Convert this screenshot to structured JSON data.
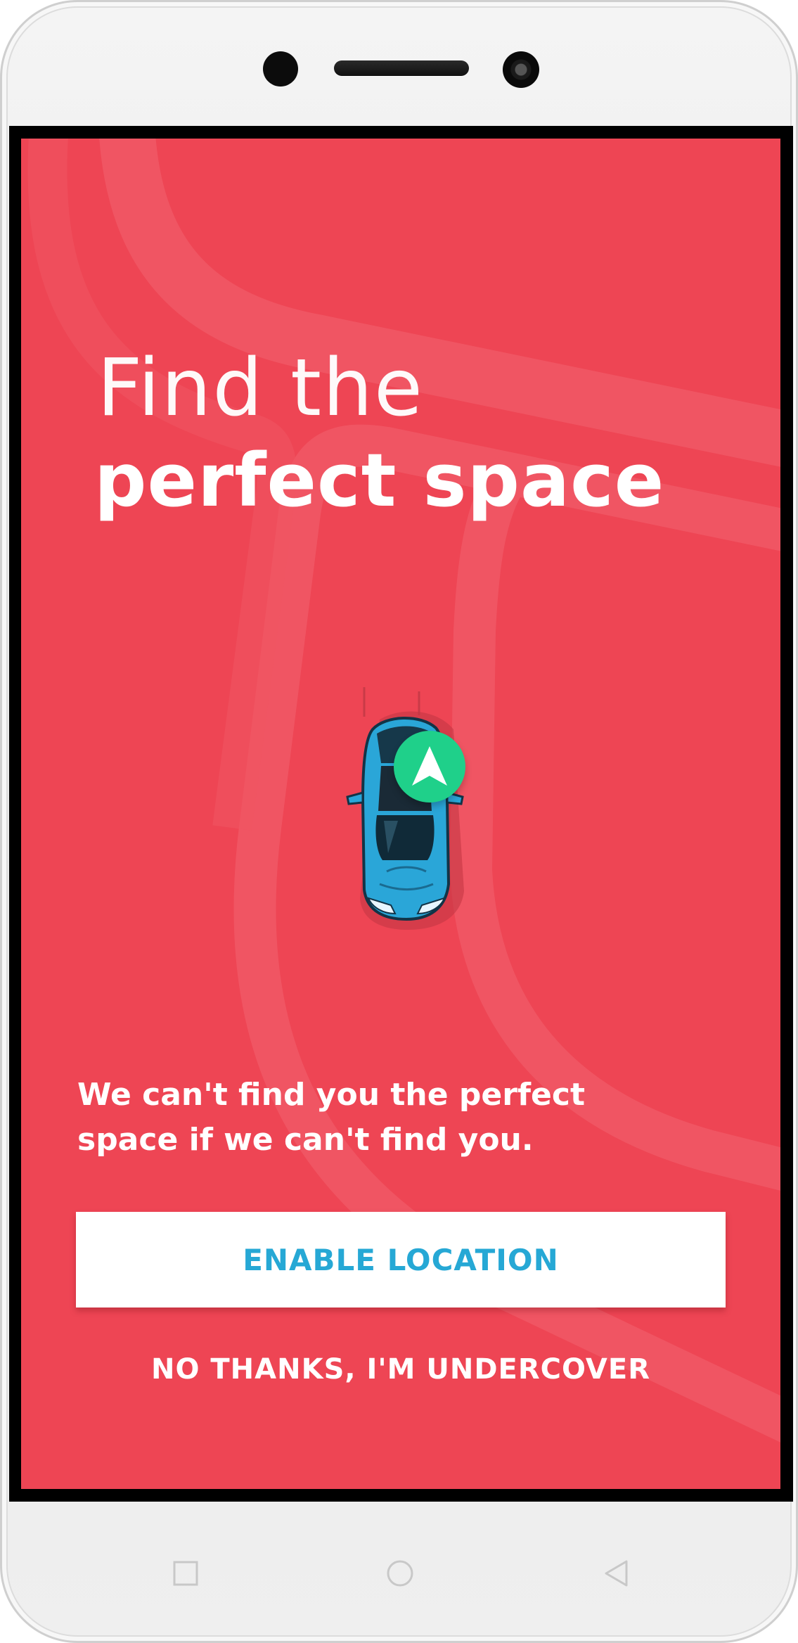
{
  "app": {
    "headline_light": "Find the",
    "headline_bold": "perfect space",
    "message": "We can't find you the perfect space if we can't find you.",
    "enable_button_label": "ENABLE LOCATION",
    "decline_label": "NO THANKS, I'M UNDERCOVER"
  },
  "colors": {
    "background": "#ee4554",
    "road": "#f05563",
    "button_text": "#26a8d5",
    "nav_badge": "#1fd08a",
    "car_body": "#2aa6d8"
  },
  "icons": {
    "car": "car-icon",
    "navigation": "navigation-arrow-icon",
    "nav_recents": "square-icon",
    "nav_home": "circle-icon",
    "nav_back": "triangle-back-icon"
  }
}
